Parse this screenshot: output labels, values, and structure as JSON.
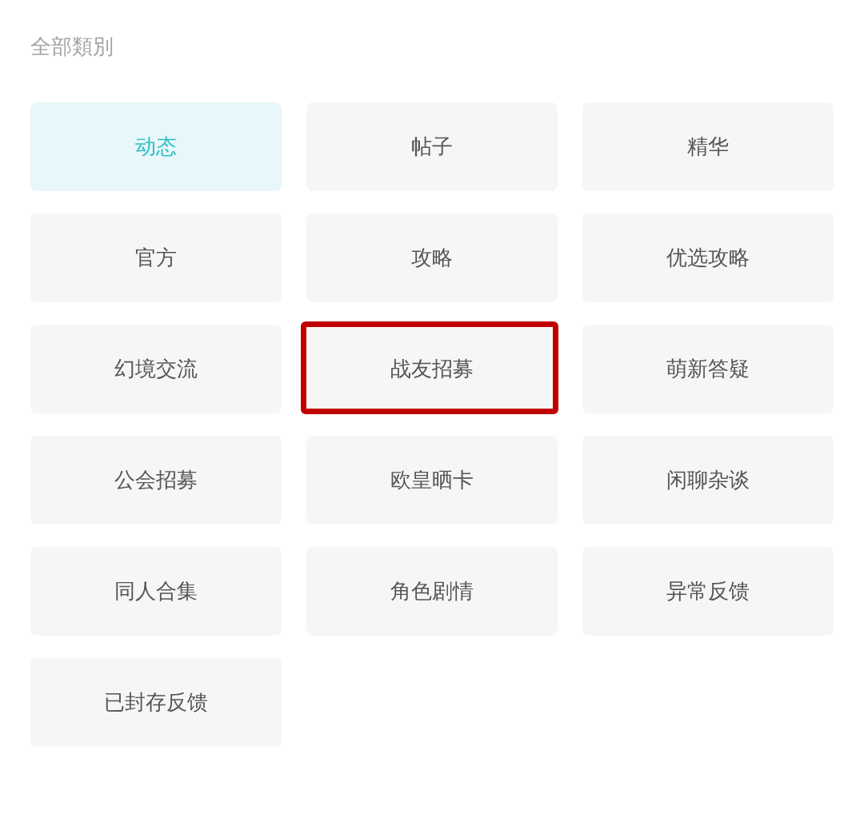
{
  "header": {
    "title": "全部類別"
  },
  "categories": [
    {
      "label": "动态",
      "selected": true,
      "highlighted": false
    },
    {
      "label": "帖子",
      "selected": false,
      "highlighted": false
    },
    {
      "label": "精华",
      "selected": false,
      "highlighted": false
    },
    {
      "label": "官方",
      "selected": false,
      "highlighted": false
    },
    {
      "label": "攻略",
      "selected": false,
      "highlighted": false
    },
    {
      "label": "优选攻略",
      "selected": false,
      "highlighted": false
    },
    {
      "label": "幻境交流",
      "selected": false,
      "highlighted": false
    },
    {
      "label": "战友招募",
      "selected": false,
      "highlighted": true
    },
    {
      "label": "萌新答疑",
      "selected": false,
      "highlighted": false
    },
    {
      "label": "公会招募",
      "selected": false,
      "highlighted": false
    },
    {
      "label": "欧皇晒卡",
      "selected": false,
      "highlighted": false
    },
    {
      "label": "闲聊杂谈",
      "selected": false,
      "highlighted": false
    },
    {
      "label": "同人合集",
      "selected": false,
      "highlighted": false
    },
    {
      "label": "角色剧情",
      "selected": false,
      "highlighted": false
    },
    {
      "label": "异常反馈",
      "selected": false,
      "highlighted": false
    },
    {
      "label": "已封存反馈",
      "selected": false,
      "highlighted": false
    }
  ]
}
